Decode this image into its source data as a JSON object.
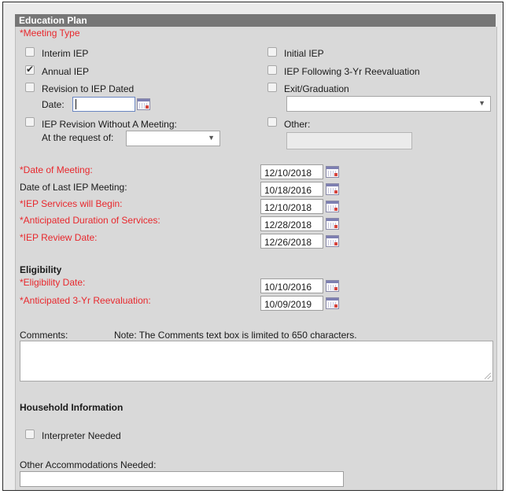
{
  "header": {
    "title": "Education Plan"
  },
  "meeting_type": {
    "label": "*Meeting Type",
    "options": {
      "interim": {
        "label": "Interim IEP",
        "checked": false
      },
      "initial": {
        "label": "Initial IEP",
        "checked": false
      },
      "annual": {
        "label": "Annual IEP",
        "checked": true
      },
      "following_reeval": {
        "label": "IEP Following 3-Yr Reevaluation",
        "checked": false
      },
      "revision_dated": {
        "label": "Revision to IEP Dated",
        "checked": false,
        "date_label": "Date:",
        "date_value": ""
      },
      "exit": {
        "label": "Exit/Graduation",
        "checked": false,
        "select_value": ""
      },
      "revision_no_meeting": {
        "label": "IEP Revision Without A Meeting:",
        "checked": false,
        "request_label": "At the request of:",
        "request_value": ""
      },
      "other": {
        "label": "Other:",
        "checked": false,
        "value": ""
      }
    }
  },
  "dates": {
    "date_of_meeting": {
      "label": "*Date of Meeting:",
      "value": "12/10/2018"
    },
    "last_iep_meeting": {
      "label": "Date of Last IEP Meeting:",
      "value": "10/18/2016"
    },
    "services_begin": {
      "label": "*IEP Services will Begin:",
      "value": "12/10/2018"
    },
    "anticipated_duration": {
      "label": "*Anticipated Duration of Services:",
      "value": "12/28/2018"
    },
    "review_date": {
      "label": "*IEP Review Date:",
      "value": "12/26/2018"
    }
  },
  "eligibility": {
    "heading": "Eligibility",
    "eligibility_date": {
      "label": "*Eligibility Date:",
      "value": "10/10/2016"
    },
    "reevaluation": {
      "label": "*Anticipated 3-Yr Reevaluation:",
      "value": "10/09/2019"
    }
  },
  "comments": {
    "label": "Comments:",
    "note": "Note: The Comments text box is limited to 650 characters.",
    "value": ""
  },
  "household": {
    "heading": "Household Information",
    "interpreter": {
      "label": "Interpreter Needed",
      "checked": false
    },
    "accommodations": {
      "label": "Other Accommodations Needed:",
      "value": ""
    }
  },
  "colors": {
    "required": "#e8282d",
    "header_bg": "#767676",
    "panel_bg": "#d9d9d9"
  }
}
